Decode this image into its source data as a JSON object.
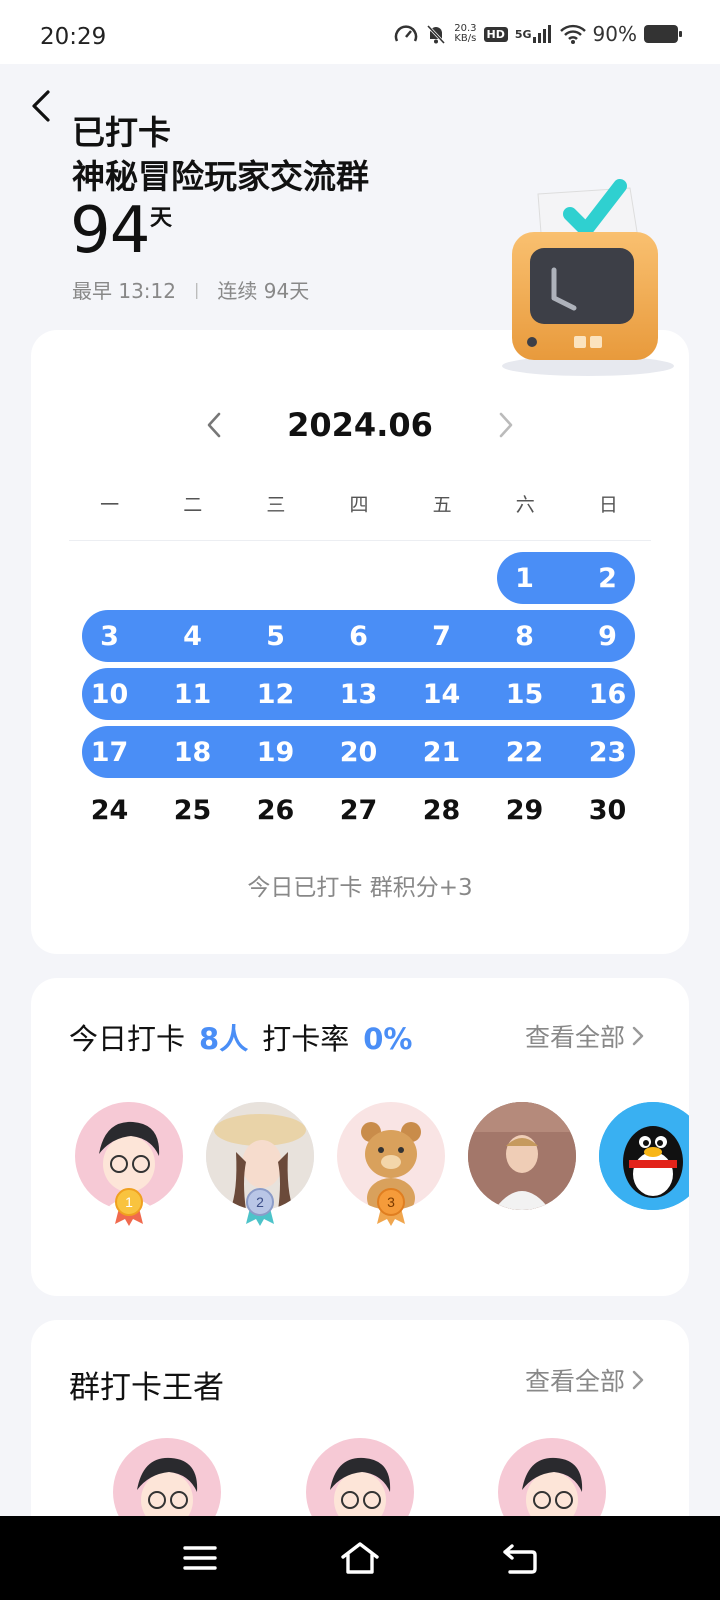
{
  "status_bar": {
    "time": "20:29",
    "net_speed_value": "20.3",
    "net_speed_unit": "KB/s",
    "hd": "HD",
    "network": "5G",
    "battery": "90%"
  },
  "header": {
    "title_line1": "已打卡",
    "title_line2": "神秘冒险玩家交流群",
    "days": "94",
    "days_unit": "天",
    "earliest": "最早 13:12",
    "separator": "|",
    "streak": "连续 94天"
  },
  "calendar": {
    "month": "2024.06",
    "weekdays": [
      "一",
      "二",
      "三",
      "四",
      "五",
      "六",
      "日"
    ],
    "rows": [
      [
        null,
        null,
        null,
        null,
        null,
        "1",
        "2"
      ],
      [
        "3",
        "4",
        "5",
        "6",
        "7",
        "8",
        "9"
      ],
      [
        "10",
        "11",
        "12",
        "13",
        "14",
        "15",
        "16"
      ],
      [
        "17",
        "18",
        "19",
        "20",
        "21",
        "22",
        "23"
      ],
      [
        "24",
        "25",
        "26",
        "27",
        "28",
        "29",
        "30"
      ]
    ],
    "checked_through": 23,
    "today_note": "今日已打卡  群积分+3",
    "accent_color": "#4a8ef6"
  },
  "today_card": {
    "label": "今日打卡",
    "count": "8人",
    "rate_label": "打卡率",
    "rate": "0%",
    "view_all": "查看全部",
    "avatars": [
      {
        "medal": "1"
      },
      {
        "medal": "2"
      },
      {
        "medal": "3"
      },
      {
        "medal": ""
      },
      {
        "medal": ""
      }
    ]
  },
  "king_card": {
    "title": "群打卡王者",
    "view_all": "查看全部"
  }
}
